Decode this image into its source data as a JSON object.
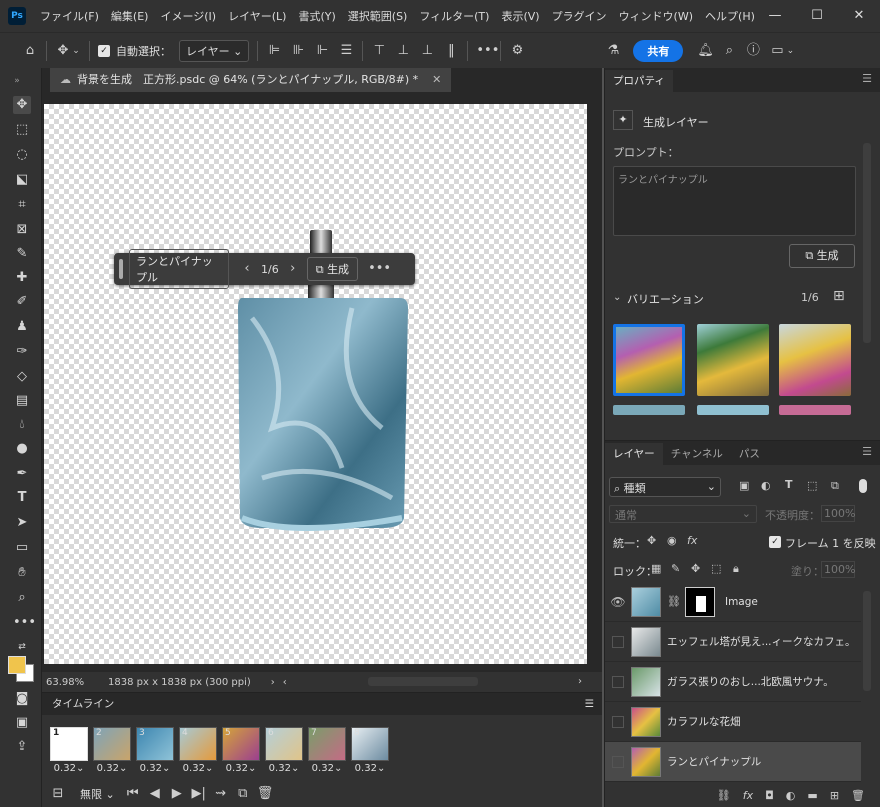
{
  "menubar": {
    "logo": "Ps",
    "items": [
      "ファイル(F)",
      "編集(E)",
      "イメージ(I)",
      "レイヤー(L)",
      "書式(Y)",
      "選択範囲(S)",
      "フィルター(T)",
      "表示(V)",
      "プラグイン",
      "ウィンドウ(W)",
      "ヘルプ(H)"
    ]
  },
  "options": {
    "auto_select_label": "自動選択：",
    "auto_select_target": "レイヤー",
    "share_label": "共有"
  },
  "document": {
    "tab_title": "背景を生成　正方形.psdc @ 64% (ランとパイナップル, RGB/8#) *",
    "zoom": "63.98%",
    "doc_info": "1838 px x 1838 px (300 ppi)"
  },
  "context_bar": {
    "prompt": "ランとパイナップル",
    "variation_index": "1/6",
    "generate_label": "生成"
  },
  "timeline": {
    "title": "タイムライン",
    "frames": [
      {
        "num": "1",
        "duration": "0.32"
      },
      {
        "num": "2",
        "duration": "0.32"
      },
      {
        "num": "3",
        "duration": "0.32"
      },
      {
        "num": "4",
        "duration": "0.32"
      },
      {
        "num": "5",
        "duration": "0.32"
      },
      {
        "num": "6",
        "duration": "0.32"
      },
      {
        "num": "7",
        "duration": "0.32"
      },
      {
        "num": "8",
        "duration": "0.32"
      }
    ],
    "loop": "無限"
  },
  "properties": {
    "tab": "プロパティ",
    "layer_type": "生成レイヤー",
    "prompt_label": "プロンプト：",
    "prompt_value": "ランとパイナップル",
    "generate_label": "生成",
    "variations_label": "バリエーション",
    "variations_count": "1/6"
  },
  "layers_panel": {
    "tabs": [
      "レイヤー",
      "チャンネル",
      "パス"
    ],
    "filter_kind": "種類",
    "blend_mode": "通常",
    "opacity_label": "不透明度：",
    "opacity_value": "100%",
    "unify_label": "統一：",
    "propagate_label": "フレーム 1 を反映",
    "lock_label": "ロック：",
    "fill_label": "塗り：",
    "fill_value": "100%",
    "layers": [
      {
        "name": "Image",
        "visible": true
      },
      {
        "name": "エッフェル塔が見え...ィークなカフェ。",
        "visible": false
      },
      {
        "name": "ガラス張りのおし...北欧風サウナ。",
        "visible": false
      },
      {
        "name": "カラフルな花畑",
        "visible": false
      },
      {
        "name": "ランとパイナップル",
        "visible": false
      }
    ]
  },
  "colors": {
    "accent": "#1473e6",
    "foreground": "#f0c44c",
    "background": "#ffffff"
  }
}
